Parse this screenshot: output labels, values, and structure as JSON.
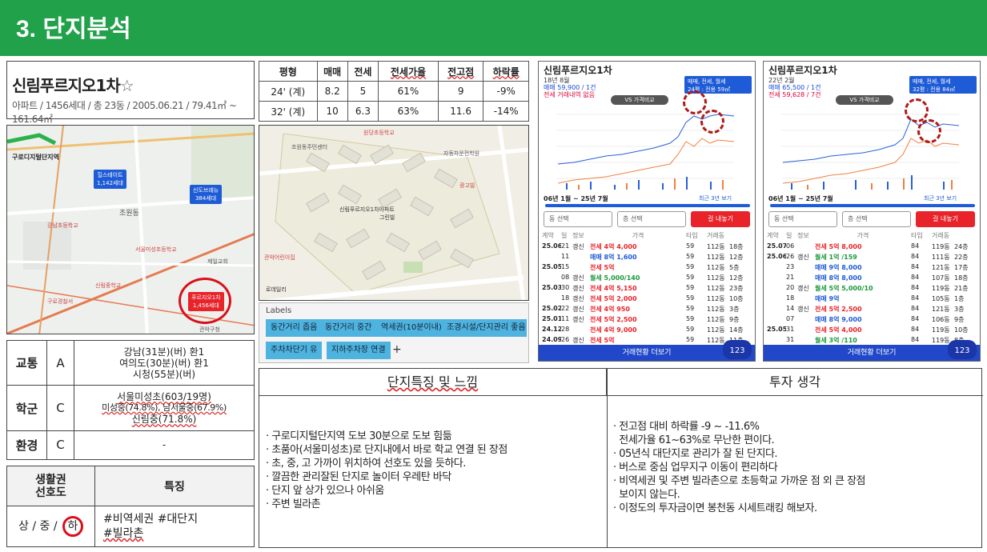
{
  "header": {
    "title": "3. 단지분석"
  },
  "complex": {
    "name": "신림푸르지오1차",
    "star": "☆",
    "info": "아파트 / 1456세대 / 총 23동 / 2005.06.21 / 79.41㎡ ~ 161.64㎡"
  },
  "price_table": {
    "headers": [
      "평형",
      "매매",
      "전세",
      "전세가율",
      "전고점",
      "하락률"
    ],
    "rows": [
      [
        "24' (계)",
        "8.2",
        "5",
        "61%",
        "9",
        "-9%"
      ],
      [
        "32' (계)",
        "10",
        "6.3",
        "63%",
        "11.6",
        "-14%"
      ]
    ]
  },
  "map1": {
    "station_label": "구로디지털단지역",
    "pin1": {
      "name": "힐스테이트",
      "count": "1,142세대"
    },
    "pin2": {
      "name": "신도브래뉴",
      "count": "384세대"
    },
    "pin3": {
      "name": "푸르지오1차",
      "count": "1,456세대"
    },
    "places": [
      "조원동",
      "구로디지털단지역",
      "강남초등학교",
      "신림중학교",
      "서울미성초등학교",
      "구로경찰서",
      "제일교회",
      "관악구청"
    ]
  },
  "map2": {
    "places": [
      "원당초등학교",
      "조원동주민센터",
      "신림푸르지오1차아파트",
      "그린빌",
      "광고빌",
      "로데일리",
      "관악어린이집",
      "자동차운전학원"
    ]
  },
  "labels": {
    "title": "Labels",
    "tags": [
      "동간거리 좁음",
      "동간거리 중간",
      "역세권(10분이내)",
      "조경시설/단지관리 좋음",
      "주차차단기 유",
      "지하주차장 연결"
    ],
    "plus": "+"
  },
  "charts": [
    {
      "title": "신림푸르지오1차",
      "date": "18년 8월",
      "sale": "매매 59,900 / 1건",
      "jeonse": "전세 거래내역 없음",
      "filter": "매매, 전세, 월세",
      "size": "24평 : 전용 59㎡",
      "compare": "VS 가격비교",
      "range": "06년 1월 ~ 25년 7월",
      "recent": "최근 3년 보기",
      "sel1": "동 선택",
      "sel2": "층 선택",
      "btn": "걸 내놓기",
      "cols": [
        "계약",
        "일",
        "정보",
        "가격",
        "타입",
        "거래동"
      ],
      "rows": [
        [
          "25.06",
          "21",
          "갱신",
          "전세 4억 4,000",
          "59",
          "112동",
          "18층"
        ],
        [
          "",
          "11",
          "",
          "매매 8억 1,600",
          "59",
          "112동",
          "12층"
        ],
        [
          "25.05",
          "15",
          "",
          "전세 5억",
          "59",
          "112동",
          "5층"
        ],
        [
          "",
          "08",
          "갱신",
          "월세 5,000/140",
          "59",
          "112동",
          "12층"
        ],
        [
          "25.03",
          "30",
          "갱신",
          "전세 4억 5,150",
          "59",
          "112동",
          "23층"
        ],
        [
          "",
          "18",
          "갱신",
          "전세 5억 2,000",
          "59",
          "112동",
          "10층"
        ],
        [
          "25.02",
          "22",
          "갱신",
          "전세 4억 950",
          "59",
          "112동",
          "3층"
        ],
        [
          "25.01",
          "11",
          "갱신",
          "전세 5억 2,500",
          "59",
          "112동",
          "9층"
        ],
        [
          "24.12",
          "28",
          "",
          "전세 4억 9,000",
          "59",
          "112동",
          "14층"
        ],
        [
          "24.09",
          "26",
          "갱신",
          "전세 5억",
          "59",
          "112동",
          "11층"
        ]
      ],
      "more": "거래현황 더보기",
      "badge": "123"
    },
    {
      "title": "신림푸르지오1차",
      "date": "22년 2월",
      "sale": "매매 65,500 / 1건",
      "jeonse": "전세 59,628 / 7건",
      "filter": "매매, 전세, 월세",
      "size": "32평 : 전용 84㎡",
      "compare": "VS 가격비교",
      "range": "06년 1월 ~ 25년 7월",
      "recent": "최근 3년 보기",
      "sel1": "동 선택",
      "sel2": "층 선택",
      "btn": "걸 내놓기",
      "cols": [
        "계약",
        "일",
        "정보",
        "가격",
        "타입",
        "거래동"
      ],
      "rows": [
        [
          "25.07",
          "06",
          "",
          "전세 5억 8,000",
          "84",
          "119동",
          "24층"
        ],
        [
          "25.06",
          "26",
          "갱신",
          "월세 1억 /159",
          "84",
          "111동",
          "22층"
        ],
        [
          "",
          "23",
          "",
          "매매 9억 8,000",
          "84",
          "121동",
          "17층"
        ],
        [
          "",
          "21",
          "",
          "매매 8억 8,000",
          "84",
          "107동",
          "18층"
        ],
        [
          "",
          "20",
          "갱신",
          "월세 5억 5,000/10",
          "84",
          "119동",
          "21층"
        ],
        [
          "",
          "18",
          "",
          "매매 9억",
          "84",
          "105동",
          "1층"
        ],
        [
          "",
          "14",
          "갱신",
          "전세 5억 2,500",
          "84",
          "121동",
          "3층"
        ],
        [
          "",
          "07",
          "",
          "매매 8억 9,000",
          "84",
          "106동",
          "9층"
        ],
        [
          "25.05",
          "31",
          "",
          "전세 5억 4,000",
          "84",
          "119동",
          "10층"
        ],
        [
          "",
          "31",
          "",
          "월세 3억 /110",
          "84",
          "119동",
          "8층"
        ]
      ],
      "more": "거래현황 더보기",
      "badge": "123"
    }
  ],
  "grades": [
    {
      "label": "교통",
      "grade": "A",
      "detail": [
        "강남(31분)(버) 환1",
        "여의도(30분)(버) 환1",
        "시청(55분)(버)"
      ]
    },
    {
      "label": "학군",
      "grade": "C",
      "detail": [
        "서울미성초(603/19명)",
        "미성중(74.8%), 남서울중(67.9%)",
        "신림중(71.8%)"
      ]
    },
    {
      "label": "환경",
      "grade": "C",
      "detail": [
        "-"
      ]
    }
  ],
  "life": {
    "h1": "생활권\n선호도",
    "h2": "특징",
    "rating": "상 / 중 /",
    "rating_circled": "하",
    "tags": [
      "#비역세권 #대단지",
      "#빌라촌"
    ]
  },
  "features": {
    "title": "단지특징 및 느낌",
    "items": [
      "· 구로디지털단지역 도보 30분으로 도보 힘듦",
      "· 초품아(서울미성초)로 단지내에서 바로 학교 연결 된 장점",
      "· 초, 중, 고 가까이 위치하여 선호도 있을 듯하다.",
      "· 깔끔한 관리잘된 단지로 놀이터 우레탄 바닥",
      "· 단지 앞 상가 있으나 아쉬움",
      "· 주변 빌라촌"
    ]
  },
  "invest": {
    "title": "투자 생각",
    "items": [
      "· 전고점 대비 하락률 -9 ~ -11.6%",
      "  전세가율 61~63%로 무난한 편이다.",
      "· 05년식 대단지로 관리가 잘 된 단지다.",
      "· 버스로 중심 업무지구 이동이 편리하다",
      "· 비역세권 및 주변 빌라촌으로 초등학교 가까운 점 외 큰 장점",
      "  보이지 않는다.",
      "· 이정도의 투자금이면 봉천동 시세트래킹 해보자."
    ]
  }
}
